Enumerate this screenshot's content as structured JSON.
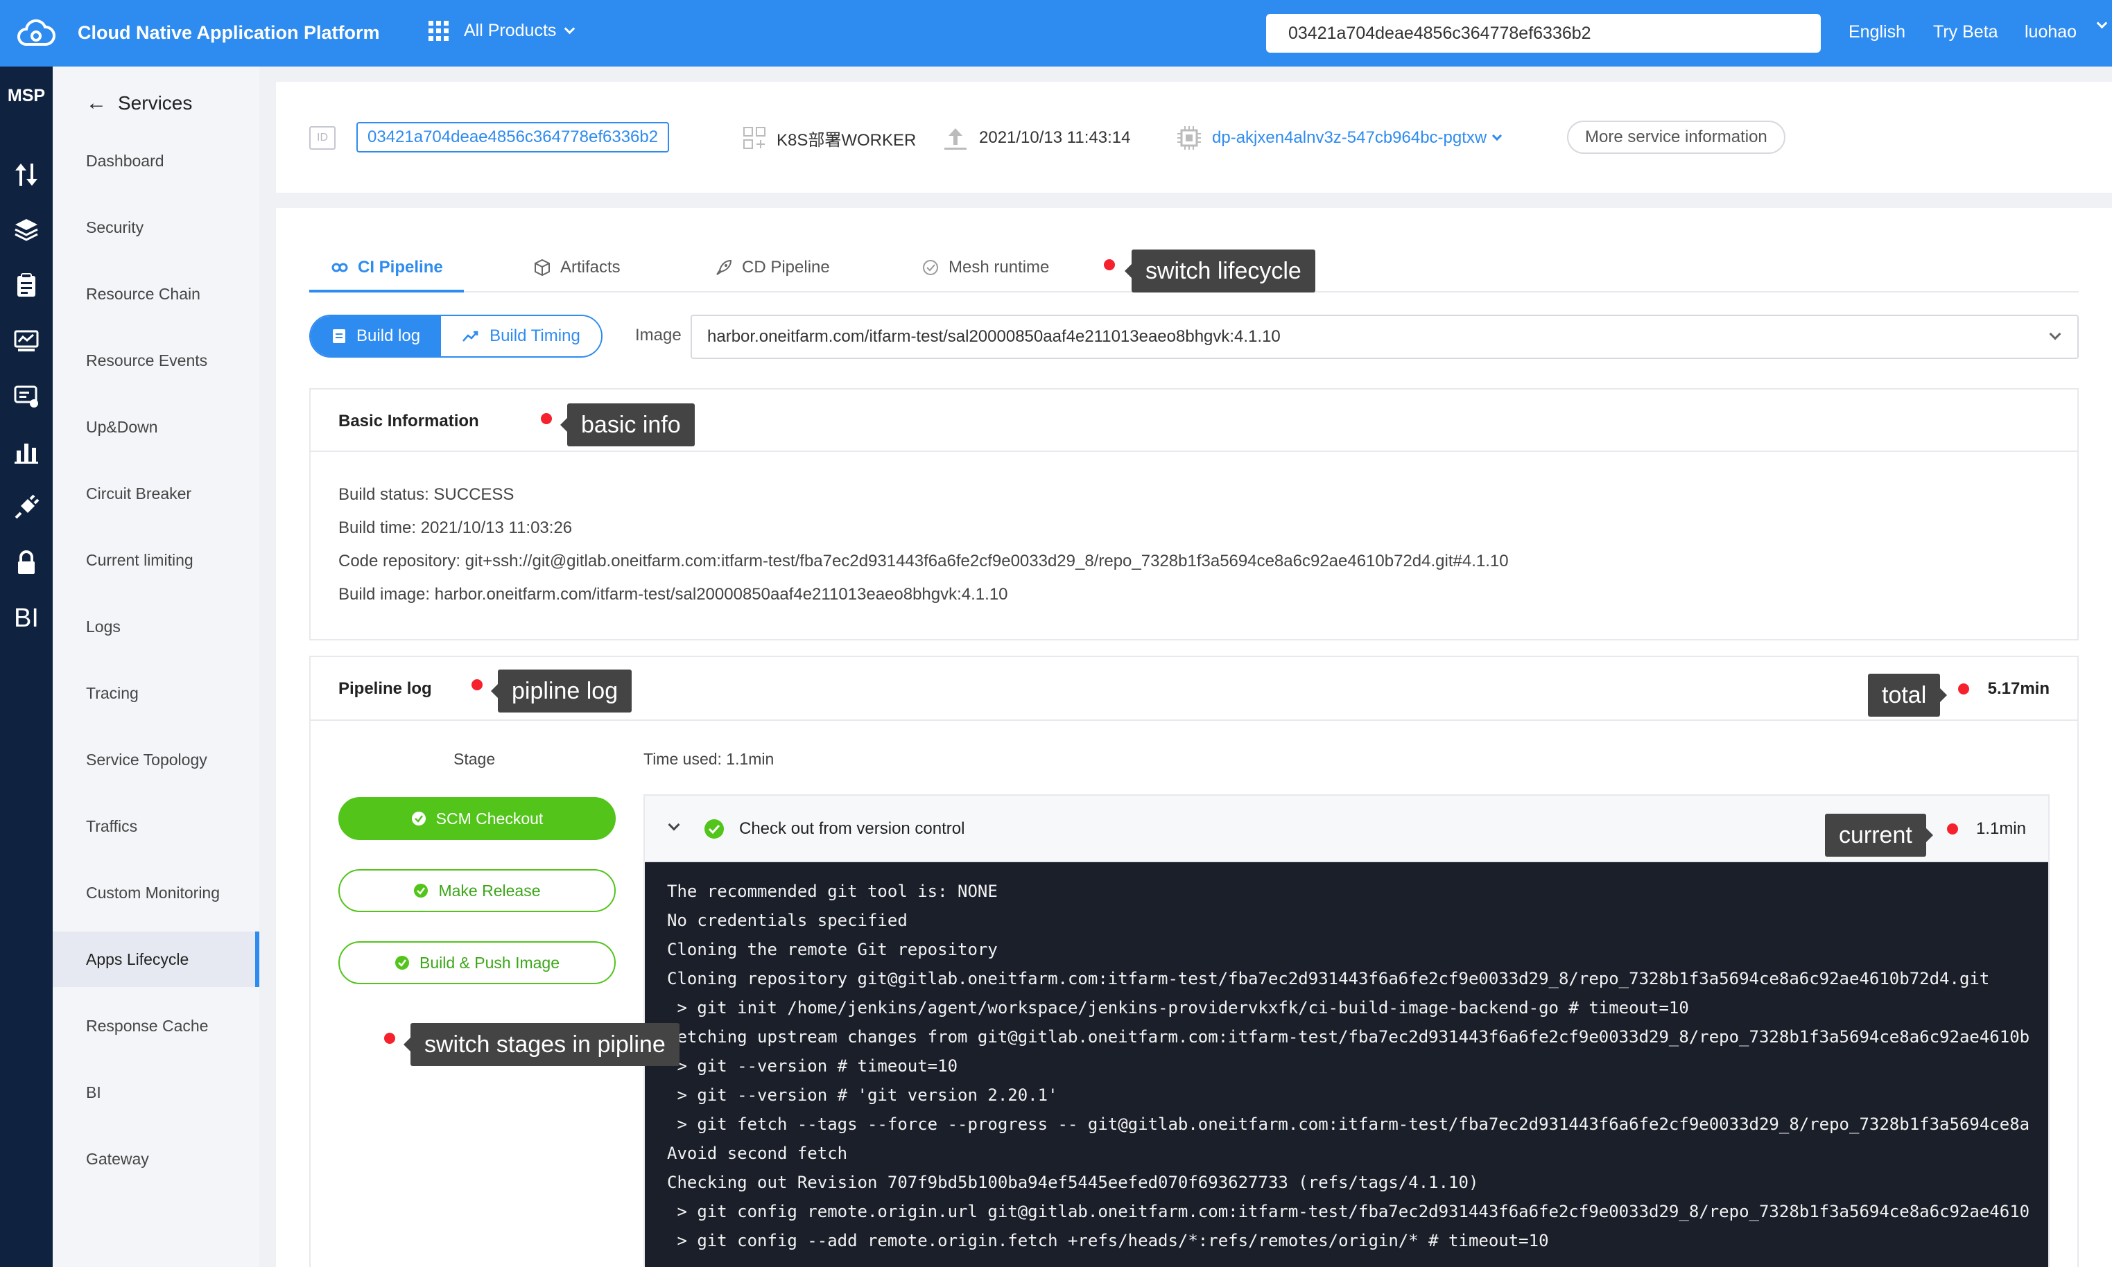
{
  "header": {
    "brand": "Cloud Native Application Platform",
    "products_label": "All Products",
    "search_value": "03421a704deae4856c364778ef6336b2",
    "language": "English",
    "try_beta": "Try Beta",
    "user": "luohao",
    "accent_color": "#2e8bf0"
  },
  "rail": {
    "title": "MSP",
    "icons": [
      "up-down-arrows-icon",
      "layers-icon",
      "clipboard-icon",
      "monitor-icon",
      "chat-settings-icon",
      "bar-chart-icon",
      "plug-icon",
      "lock-icon",
      "bi-icon"
    ],
    "bi_label": "BI"
  },
  "sidebar": {
    "back_label": "Services",
    "items": [
      {
        "label": "Dashboard"
      },
      {
        "label": "Security"
      },
      {
        "label": "Resource Chain"
      },
      {
        "label": "Resource Events"
      },
      {
        "label": "Up&Down"
      },
      {
        "label": "Circuit Breaker"
      },
      {
        "label": "Current limiting"
      },
      {
        "label": "Logs"
      },
      {
        "label": "Tracing"
      },
      {
        "label": "Service Topology"
      },
      {
        "label": "Traffics"
      },
      {
        "label": "Custom Monitoring"
      },
      {
        "label": "Apps Lifecycle",
        "active": true
      },
      {
        "label": "Response Cache"
      },
      {
        "label": "BI"
      },
      {
        "label": "Gateway"
      }
    ]
  },
  "service_info": {
    "id_tag": "ID",
    "id": "03421a704deae4856c364778ef6336b2",
    "deploy_type": "K8S部署WORKER",
    "updated_at": "2021/10/13 11:43:14",
    "pod": "dp-akjxen4alnv3z-547cb964bc-pgtxw",
    "more_label": "More service information"
  },
  "tabs": [
    {
      "label": "CI Pipeline",
      "icon": "link-icon",
      "active": true
    },
    {
      "label": "Artifacts",
      "icon": "cube-icon"
    },
    {
      "label": "CD Pipeline",
      "icon": "rocket-icon"
    },
    {
      "label": "Mesh runtime",
      "icon": "mesh-icon"
    }
  ],
  "toolbar": {
    "build_log": "Build log",
    "build_timing": "Build Timing",
    "image_label": "Image",
    "image_value": "harbor.oneitfarm.com/itfarm-test/sal20000850aaf4e211013eaeo8bhgvk:4.1.10"
  },
  "basic_info": {
    "title": "Basic Information",
    "lines": [
      "Build status: SUCCESS",
      "Build time: 2021/10/13 11:03:26",
      "Code repository: git+ssh://git@gitlab.oneitfarm.com:itfarm-test/fba7ec2d931443f6a6fe2cf9e0033d29_8/repo_7328b1f3a5694ce8a6c92ae4610b72d4.git#4.1.10",
      "Build image: harbor.oneitfarm.com/itfarm-test/sal20000850aaf4e211013eaeo8bhgvk:4.1.10"
    ]
  },
  "pipeline": {
    "title": "Pipeline log",
    "total": "5.17min",
    "stage_header": "Stage",
    "time_used": "Time used: 1.1min",
    "stages": [
      {
        "label": "SCM Checkout",
        "active": true
      },
      {
        "label": "Make Release"
      },
      {
        "label": "Build & Push Image"
      }
    ],
    "step": {
      "title": "Check out from version control",
      "time": "1.1min"
    },
    "log_lines": [
      "The recommended git tool is: NONE",
      "No credentials specified",
      "Cloning the remote Git repository",
      "Cloning repository git@gitlab.oneitfarm.com:itfarm-test/fba7ec2d931443f6a6fe2cf9e0033d29_8/repo_7328b1f3a5694ce8a6c92ae4610b72d4.git",
      " > git init /home/jenkins/agent/workspace/jenkins-providervkxfk/ci-build-image-backend-go # timeout=10",
      "Fetching upstream changes from git@gitlab.oneitfarm.com:itfarm-test/fba7ec2d931443f6a6fe2cf9e0033d29_8/repo_7328b1f3a5694ce8a6c92ae4610b",
      " > git --version # timeout=10",
      " > git --version # 'git version 2.20.1'",
      " > git fetch --tags --force --progress -- git@gitlab.oneitfarm.com:itfarm-test/fba7ec2d931443f6a6fe2cf9e0033d29_8/repo_7328b1f3a5694ce8a",
      "Avoid second fetch",
      "Checking out Revision 707f9bd5b100ba94ef5445eefed070f693627733 (refs/tags/4.1.10)",
      " > git config remote.origin.url git@gitlab.oneitfarm.com:itfarm-test/fba7ec2d931443f6a6fe2cf9e0033d29_8/repo_7328b1f3a5694ce8a6c92ae4610",
      " > git config --add remote.origin.fetch +refs/heads/*:refs/remotes/origin/* # timeout=10"
    ]
  },
  "annotations": {
    "switch_lifecycle": "switch lifecycle",
    "basic_info": "basic info",
    "pipeline_log": "pipline log",
    "total": "total",
    "current": "current",
    "switch_stages": "switch stages in pipline"
  }
}
